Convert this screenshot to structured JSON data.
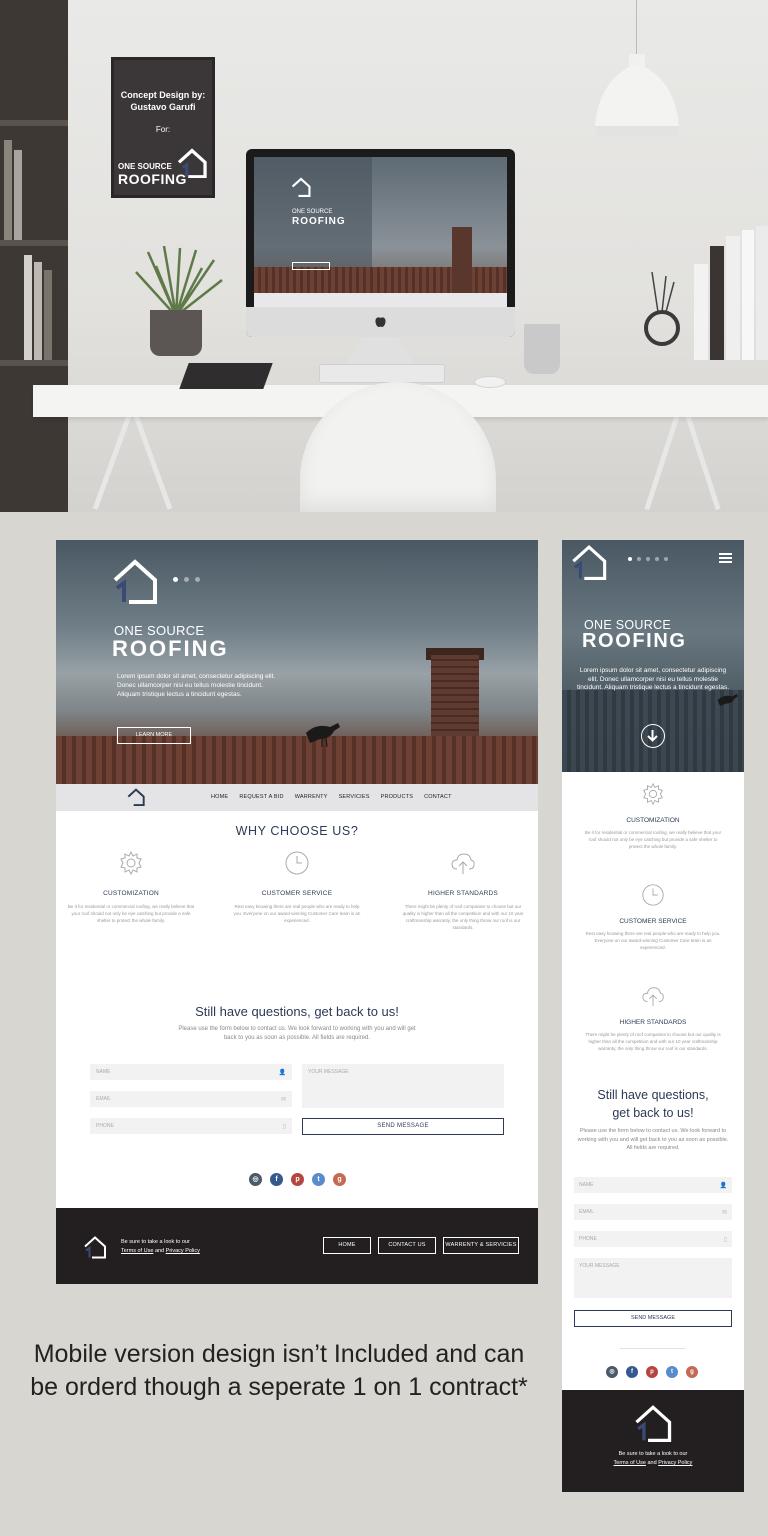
{
  "poster": {
    "line1": "Concept Design by:",
    "line2": "Gustavo Garufi",
    "line3": "For:",
    "logo_small": "ONE SOURCE",
    "logo_big": "ROOFING"
  },
  "imac_screen": {
    "title_small": "ONE SOURCE",
    "title_big": "ROOFING"
  },
  "desktop": {
    "hero": {
      "title_small": "ONE SOURCE",
      "title_big": "ROOFING",
      "body": "Lorem ipsum dolor sit amet, consectetur adipiscing elit. Donec ullamcorper nisi eu tellus molestie tincidunt. Aliquam tristique lectus a tincidunt egestas.",
      "button": "LEARN MORE"
    },
    "nav": [
      "HOME",
      "REQUEST A BID",
      "WARRENTY",
      "SERVICIES",
      "PRODUCTS",
      "CONTACT"
    ],
    "why_title": "WHY CHOOSE US?",
    "features": [
      {
        "icon": "gear-icon",
        "title": "CUSTOMIZATION",
        "body": "Be it for residential or commercial roofing, we really believe that your roof should not only be eye catching but provide a safe shelter to protect the whole family."
      },
      {
        "icon": "clock-icon",
        "title": "CUSTOMER SERVICE",
        "body": "Rest easy knowing there are real people who are ready to help you. Everyone on our award-winning Customer Care team is an experienced."
      },
      {
        "icon": "cloud-upload-icon",
        "title": "HIGHER STANDARDS",
        "body": "There might be plenty of roof companies to choose but our quality is higher than all the competition and with our 10 year craftmanship warranty, the only thing throw our roof is our standards."
      }
    ],
    "questions_title": "Still have questions, get back to us!",
    "questions_sub": "Please use the form below to contact us. We look forward to working with you and will get back to you as soon as possible. All fields are required.",
    "form": {
      "name": "NAME",
      "email": "EMAIL",
      "phone": "PHONE",
      "message": "YOUR MESSAGE",
      "send": "SEND MESSAGE"
    },
    "footer": {
      "text": "Be sure to take a look to our",
      "terms": "Terms of Use",
      "and": "and",
      "privacy": "Privacy Policy",
      "buttons": [
        "HOME",
        "CONTACT US",
        "WARRENTY & SERVICIES"
      ]
    }
  },
  "mobile": {
    "hero": {
      "title_small": "ONE SOURCE",
      "title_big": "ROOFING",
      "body": "Lorem ipsum dolor sit amet, consectetur adipiscing elit. Donec ullamcorper nisi eu tellus molestie tincidunt. Aliquam tristique lectus a tincidunt egestas."
    },
    "questions_title_1": "Still have questions,",
    "questions_title_2": "get back to us!"
  },
  "socials": [
    {
      "icon": "instagram-icon",
      "glyph": "◎",
      "color": "#4b5a6b"
    },
    {
      "icon": "facebook-icon",
      "glyph": "f",
      "color": "#35588f"
    },
    {
      "icon": "pinterest-icon",
      "glyph": "p",
      "color": "#b5453f"
    },
    {
      "icon": "twitter-icon",
      "glyph": "t",
      "color": "#5a8ccc"
    },
    {
      "icon": "google-plus-icon",
      "glyph": "g",
      "color": "#c46a52"
    }
  ],
  "note": "Mobile version design isn’t Included and can be orderd though a seperate 1 on 1 contract*"
}
